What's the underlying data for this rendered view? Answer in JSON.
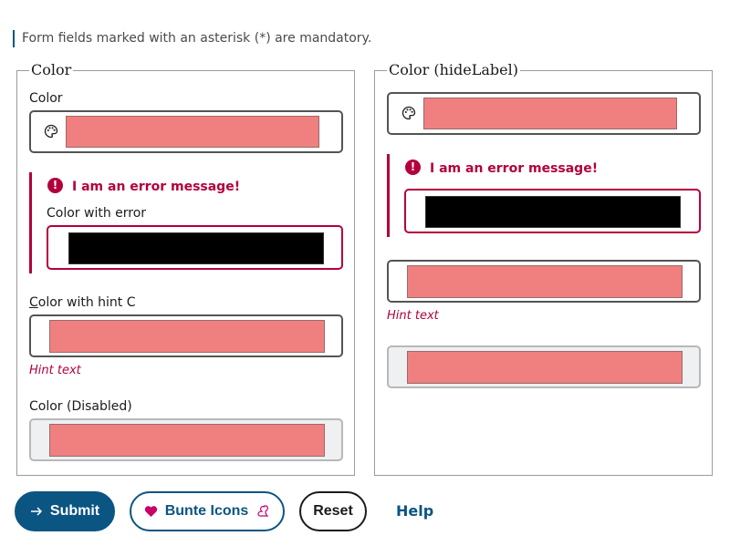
{
  "form": {
    "note": "Form fields marked with an asterisk (*) are mandatory."
  },
  "left": {
    "legend": "Color",
    "color_label": "Color",
    "error_message": "I am an error message!",
    "error_label": "Color with error",
    "hint_label_first": "C",
    "hint_label_rest": "olor with hint C",
    "hint_text": "Hint text",
    "disabled_label": "Color (Disabled)"
  },
  "right": {
    "legend": "Color (hideLabel)",
    "error_message": "I am an error message!",
    "hint_text": "Hint text"
  },
  "values": {
    "swatch_color": "#f08080",
    "error_swatch_color": "#000000"
  },
  "icons": {
    "palette": "palette-icon",
    "error": "exclamation-circle-icon",
    "arrow": "arrow-right-icon",
    "heart": "heart-icon",
    "brand": "squirrel-icon"
  },
  "actions": {
    "submit": "Submit",
    "bunte": "Bunte Icons",
    "reset": "Reset",
    "help": "Help"
  }
}
